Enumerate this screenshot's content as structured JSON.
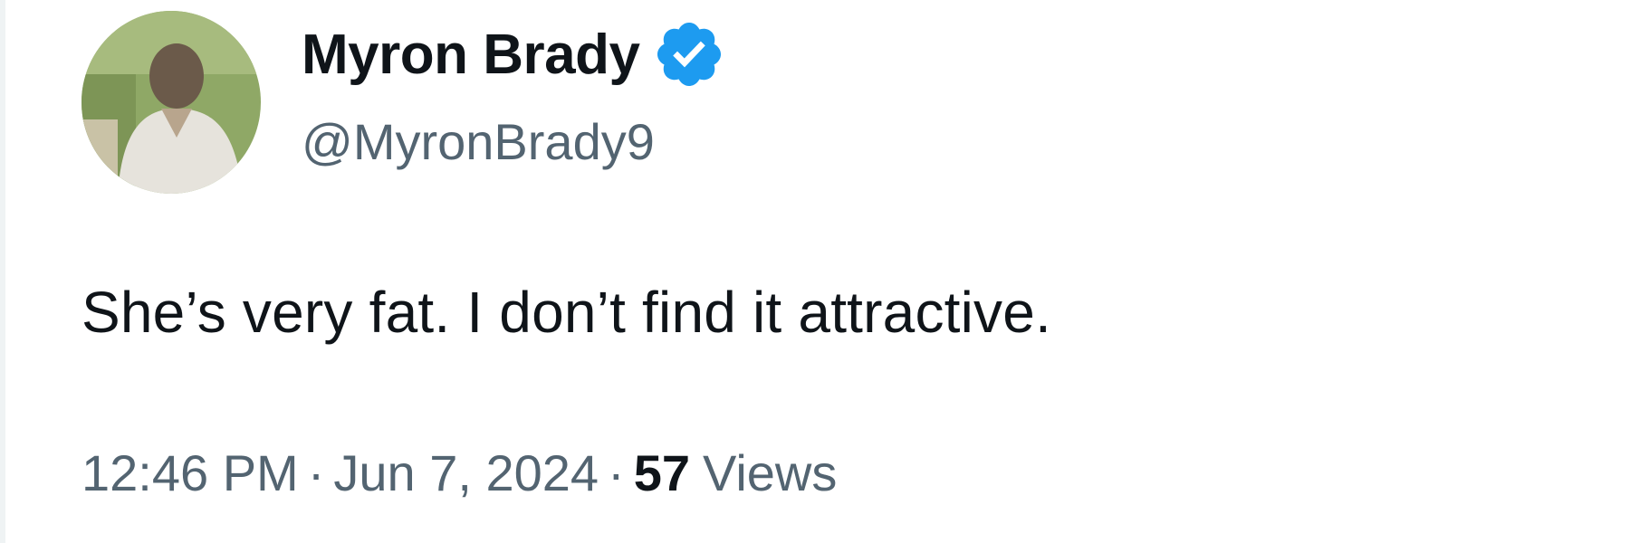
{
  "author": {
    "display_name": "Myron Brady",
    "handle": "@MyronBrady9",
    "verified_icon": "verified-badge-icon",
    "avatar_icon": "profile-photo"
  },
  "tweet": {
    "text": "She’s very fat. I don’t find it attractive.",
    "time": "12:46 PM",
    "date": "Jun 7, 2024",
    "separator": "·",
    "views_count": "57",
    "views_label": "Views"
  },
  "colors": {
    "text_primary": "#0f1419",
    "text_secondary": "#536471",
    "verified_blue": "#1d9bf0"
  }
}
